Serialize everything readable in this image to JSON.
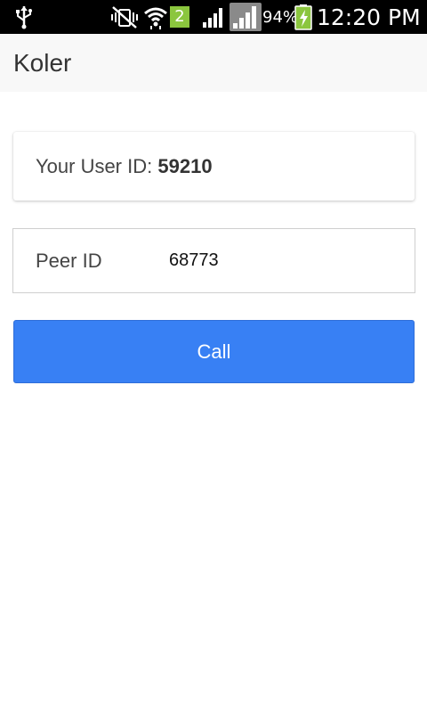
{
  "status_bar": {
    "battery_percent": "94%",
    "time": "12:20 PM",
    "wifi_badge": "2",
    "icons": [
      "usb-icon",
      "mute-vibrate-icon",
      "wifi-icon",
      "signal-icon",
      "signal-icon",
      "battery-charging-icon"
    ]
  },
  "app_bar": {
    "title": "Koler"
  },
  "user_card": {
    "label": "Your User ID:",
    "user_id": "59210"
  },
  "peer": {
    "label": "Peer ID",
    "value": "68773"
  },
  "call_button": {
    "label": "Call"
  },
  "colors": {
    "accent": "#3880f4",
    "app_bar_bg": "#f8f8f8",
    "status_bar_bg": "#000000",
    "battery_green": "#8bc63e"
  }
}
